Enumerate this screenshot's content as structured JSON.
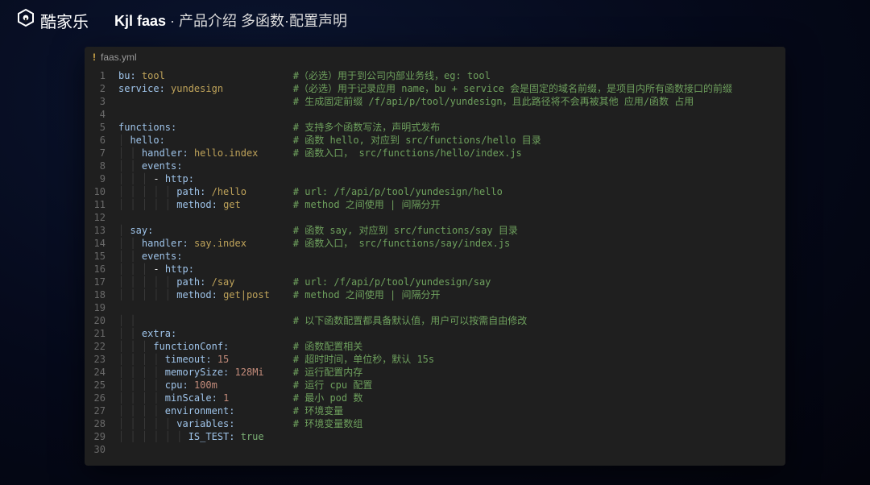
{
  "header": {
    "brand": "酷家乐",
    "title_left": "Kjl faas",
    "title_sep": " · ",
    "title_right": "产品介绍 多函数·配置声明"
  },
  "file": {
    "name": "faas.yml",
    "icon_label": "!"
  },
  "lines": [
    {
      "n": 1,
      "indent": 0,
      "tokens": [
        [
          "key",
          "bu:"
        ],
        [
          "sp",
          " "
        ],
        [
          "str",
          "tool"
        ]
      ],
      "comment": "#（必选）用于到公司内部业务线，eg: tool"
    },
    {
      "n": 2,
      "indent": 0,
      "tokens": [
        [
          "key",
          "service:"
        ],
        [
          "sp",
          " "
        ],
        [
          "str",
          "yundesign"
        ]
      ],
      "comment": "#（必选）用于记录应用 name，bu + service 会是固定的域名前缀，是项目内所有函数接口的前缀"
    },
    {
      "n": 3,
      "indent": 0,
      "tokens": [],
      "comment": "# 生成固定前缀 /f/api/p/tool/yundesign，且此路径将不会再被其他 应用/函数 占用"
    },
    {
      "n": 4,
      "indent": 0,
      "tokens": [],
      "comment": ""
    },
    {
      "n": 5,
      "indent": 0,
      "tokens": [
        [
          "key",
          "functions:"
        ]
      ],
      "comment": "# 支持多个函数写法，声明式发布"
    },
    {
      "n": 6,
      "indent": 1,
      "tokens": [
        [
          "key",
          "hello:"
        ]
      ],
      "comment": "# 函数 hello, 对应到 src/functions/hello 目录"
    },
    {
      "n": 7,
      "indent": 2,
      "tokens": [
        [
          "key",
          "handler:"
        ],
        [
          "sp",
          " "
        ],
        [
          "str",
          "hello.index"
        ]
      ],
      "comment": "# 函数入口， src/functions/hello/index.js"
    },
    {
      "n": 8,
      "indent": 2,
      "tokens": [
        [
          "key",
          "events:"
        ]
      ],
      "comment": ""
    },
    {
      "n": 9,
      "indent": 3,
      "tokens": [
        [
          "dash",
          "- "
        ],
        [
          "key",
          "http:"
        ]
      ],
      "comment": ""
    },
    {
      "n": 10,
      "indent": 5,
      "tokens": [
        [
          "key",
          "path:"
        ],
        [
          "sp",
          " "
        ],
        [
          "str",
          "/hello"
        ]
      ],
      "comment": "# url: /f/api/p/tool/yundesign/hello"
    },
    {
      "n": 11,
      "indent": 5,
      "tokens": [
        [
          "key",
          "method:"
        ],
        [
          "sp",
          " "
        ],
        [
          "str",
          "get"
        ]
      ],
      "comment": "# method 之间使用 | 间隔分开"
    },
    {
      "n": 12,
      "indent": 0,
      "tokens": [],
      "comment": ""
    },
    {
      "n": 13,
      "indent": 1,
      "tokens": [
        [
          "key",
          "say:"
        ]
      ],
      "comment": "# 函数 say, 对应到 src/functions/say 目录"
    },
    {
      "n": 14,
      "indent": 2,
      "tokens": [
        [
          "key",
          "handler:"
        ],
        [
          "sp",
          " "
        ],
        [
          "str",
          "say.index"
        ]
      ],
      "comment": "# 函数入口， src/functions/say/index.js"
    },
    {
      "n": 15,
      "indent": 2,
      "tokens": [
        [
          "key",
          "events:"
        ]
      ],
      "comment": ""
    },
    {
      "n": 16,
      "indent": 3,
      "tokens": [
        [
          "dash",
          "- "
        ],
        [
          "key",
          "http:"
        ]
      ],
      "comment": ""
    },
    {
      "n": 17,
      "indent": 5,
      "tokens": [
        [
          "key",
          "path:"
        ],
        [
          "sp",
          " "
        ],
        [
          "str",
          "/say"
        ]
      ],
      "comment": "# url: /f/api/p/tool/yundesign/say"
    },
    {
      "n": 18,
      "indent": 5,
      "tokens": [
        [
          "key",
          "method:"
        ],
        [
          "sp",
          " "
        ],
        [
          "str",
          "get|post"
        ]
      ],
      "comment": "# method 之间使用 | 间隔分开"
    },
    {
      "n": 19,
      "indent": 0,
      "tokens": [],
      "comment": ""
    },
    {
      "n": 20,
      "indent": 2,
      "tokens": [],
      "comment": "# 以下函数配置都具备默认值，用户可以按需自由修改"
    },
    {
      "n": 21,
      "indent": 2,
      "tokens": [
        [
          "key",
          "extra:"
        ]
      ],
      "comment": ""
    },
    {
      "n": 22,
      "indent": 3,
      "tokens": [
        [
          "key",
          "functionConf:"
        ]
      ],
      "comment": "# 函数配置相关"
    },
    {
      "n": 23,
      "indent": 4,
      "tokens": [
        [
          "key",
          "timeout:"
        ],
        [
          "sp",
          " "
        ],
        [
          "num",
          "15"
        ]
      ],
      "comment": "# 超时时间，单位秒，默认 15s"
    },
    {
      "n": 24,
      "indent": 4,
      "tokens": [
        [
          "key",
          "memorySize:"
        ],
        [
          "sp",
          " "
        ],
        [
          "num",
          "128Mi"
        ]
      ],
      "comment": "# 运行配置内存"
    },
    {
      "n": 25,
      "indent": 4,
      "tokens": [
        [
          "key",
          "cpu:"
        ],
        [
          "sp",
          " "
        ],
        [
          "num",
          "100m"
        ]
      ],
      "comment": "# 运行 cpu 配置"
    },
    {
      "n": 26,
      "indent": 4,
      "tokens": [
        [
          "key",
          "minScale:"
        ],
        [
          "sp",
          " "
        ],
        [
          "num",
          "1"
        ]
      ],
      "comment": "# 最小 pod 数"
    },
    {
      "n": 27,
      "indent": 4,
      "tokens": [
        [
          "key",
          "environment:"
        ]
      ],
      "comment": "# 环境变量"
    },
    {
      "n": 28,
      "indent": 5,
      "tokens": [
        [
          "key",
          "variables:"
        ]
      ],
      "comment": "# 环境变量数组"
    },
    {
      "n": 29,
      "indent": 6,
      "tokens": [
        [
          "key",
          "IS_TEST:"
        ],
        [
          "sp",
          " "
        ],
        [
          "bool",
          "true"
        ]
      ],
      "comment": ""
    },
    {
      "n": 30,
      "indent": 0,
      "tokens": [],
      "comment": ""
    }
  ],
  "layout": {
    "comment_column": 30,
    "indent_unit": "  "
  }
}
